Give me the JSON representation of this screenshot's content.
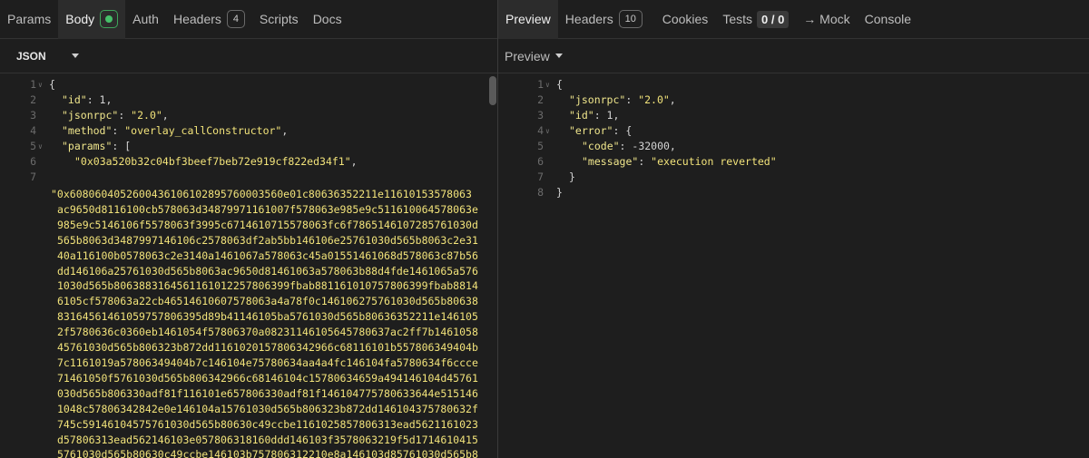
{
  "left": {
    "tabs": [
      {
        "label": "Params"
      },
      {
        "label": "Body"
      },
      {
        "label": "Auth"
      },
      {
        "label": "Headers",
        "badge": "4"
      },
      {
        "label": "Scripts"
      },
      {
        "label": "Docs"
      }
    ],
    "format_label": "JSON",
    "code_lines": [
      {
        "n": "1",
        "text": "{"
      },
      {
        "n": "2",
        "key": "\"id\"",
        "rest": ": 1,"
      },
      {
        "n": "3",
        "key": "\"jsonrpc\"",
        "rest": ": ",
        "str": "\"2.0\"",
        "end": ","
      },
      {
        "n": "4",
        "key": "\"method\"",
        "rest": ": ",
        "str": "\"overlay_callConstructor\"",
        "end": ","
      },
      {
        "n": "5",
        "key": "\"params\"",
        "rest": ": ["
      },
      {
        "n": "6",
        "str": "\"0x03a520b32c04bf3beef7beb72e919cf822ed34f1\"",
        "end": ","
      },
      {
        "n": "7",
        "text": ""
      }
    ],
    "hex_lines": [
      "\"0x6080604052600436106102895760003560e01c80636352211e11610153578063",
      "ac9650d8116100cb578063d34879971161007f578063e985e9c511610064578063e",
      "985e9c5146106f5578063f3995c6714610715578063fc6f786514610728576103 0d",
      "565b8063d3487997146106c2578063df2ab5bb146106e25761030d565b8063c2e31",
      "40a116100b0578063c2e3140a1461067a578063c45a01551461068d578063c87b56",
      "dd146106a25761030d565b8063ac9650d81461063a578063b88d4fde1461065a576",
      "1030d565b806388316456116101225780 6399fbab8811610107578063 99fbab8814",
      "6105cf578063a22cb4651461060757806 3a4a78f0c146106275761030d565b80638",
      "8316456146105975780 6395d89b41146105ba5761030d565b80636352211e146105",
      "2f5780636c0360eb1461054f57806370a082311461056457806 37ac2ff7b1461058",
      "45761030d565b806323b872dd1161020157806342966c68116101b5578063494 04b",
      "7c1161019a57806349404b7c146104e75780634aa4a4fc146104fa5780634f6ccce",
      "71461050f5761030d565b806342966c68146104c15780634659a494146104d45761",
      "030d565b8063 30adf81f116101e6578063 30adf81f14610477578063 3644e515146",
      "1048c578063428 42e0e146104a15761030d565b806323b872dd146104375780632f",
      "745c591461045757610 30d565b80630c49ccbe116102585780 6313ead5621161023",
      "d57806313ead562146103e057806318160ddd146103f3578063219f5d1714610415",
      "5761030d565b80630c49ccbe146103b757806312210e8a146103d857610 30d565b8"
    ]
  },
  "right": {
    "tabs": [
      {
        "label": "Preview"
      },
      {
        "label": "Headers",
        "badge": "10"
      },
      {
        "label": "Cookies"
      },
      {
        "label": "Tests",
        "count": "0 / 0"
      },
      {
        "label": "→ Mock"
      },
      {
        "label": "Console"
      }
    ],
    "preview_label": "Preview",
    "code_lines": [
      {
        "n": "1",
        "text": "{"
      },
      {
        "n": "2",
        "key": "\"jsonrpc\"",
        "rest": ": ",
        "str": "\"2.0\"",
        "end": ","
      },
      {
        "n": "3",
        "key": "\"id\"",
        "rest": ": 1,"
      },
      {
        "n": "4",
        "key": "\"error\"",
        "rest": ": {"
      },
      {
        "n": "5",
        "key": "\"code\"",
        "rest": ": -32000,"
      },
      {
        "n": "6",
        "key": "\"message\"",
        "rest": ": ",
        "str": "\"execution reverted\""
      },
      {
        "n": "7",
        "text": "}"
      },
      {
        "n": "8",
        "text": "}"
      }
    ]
  }
}
